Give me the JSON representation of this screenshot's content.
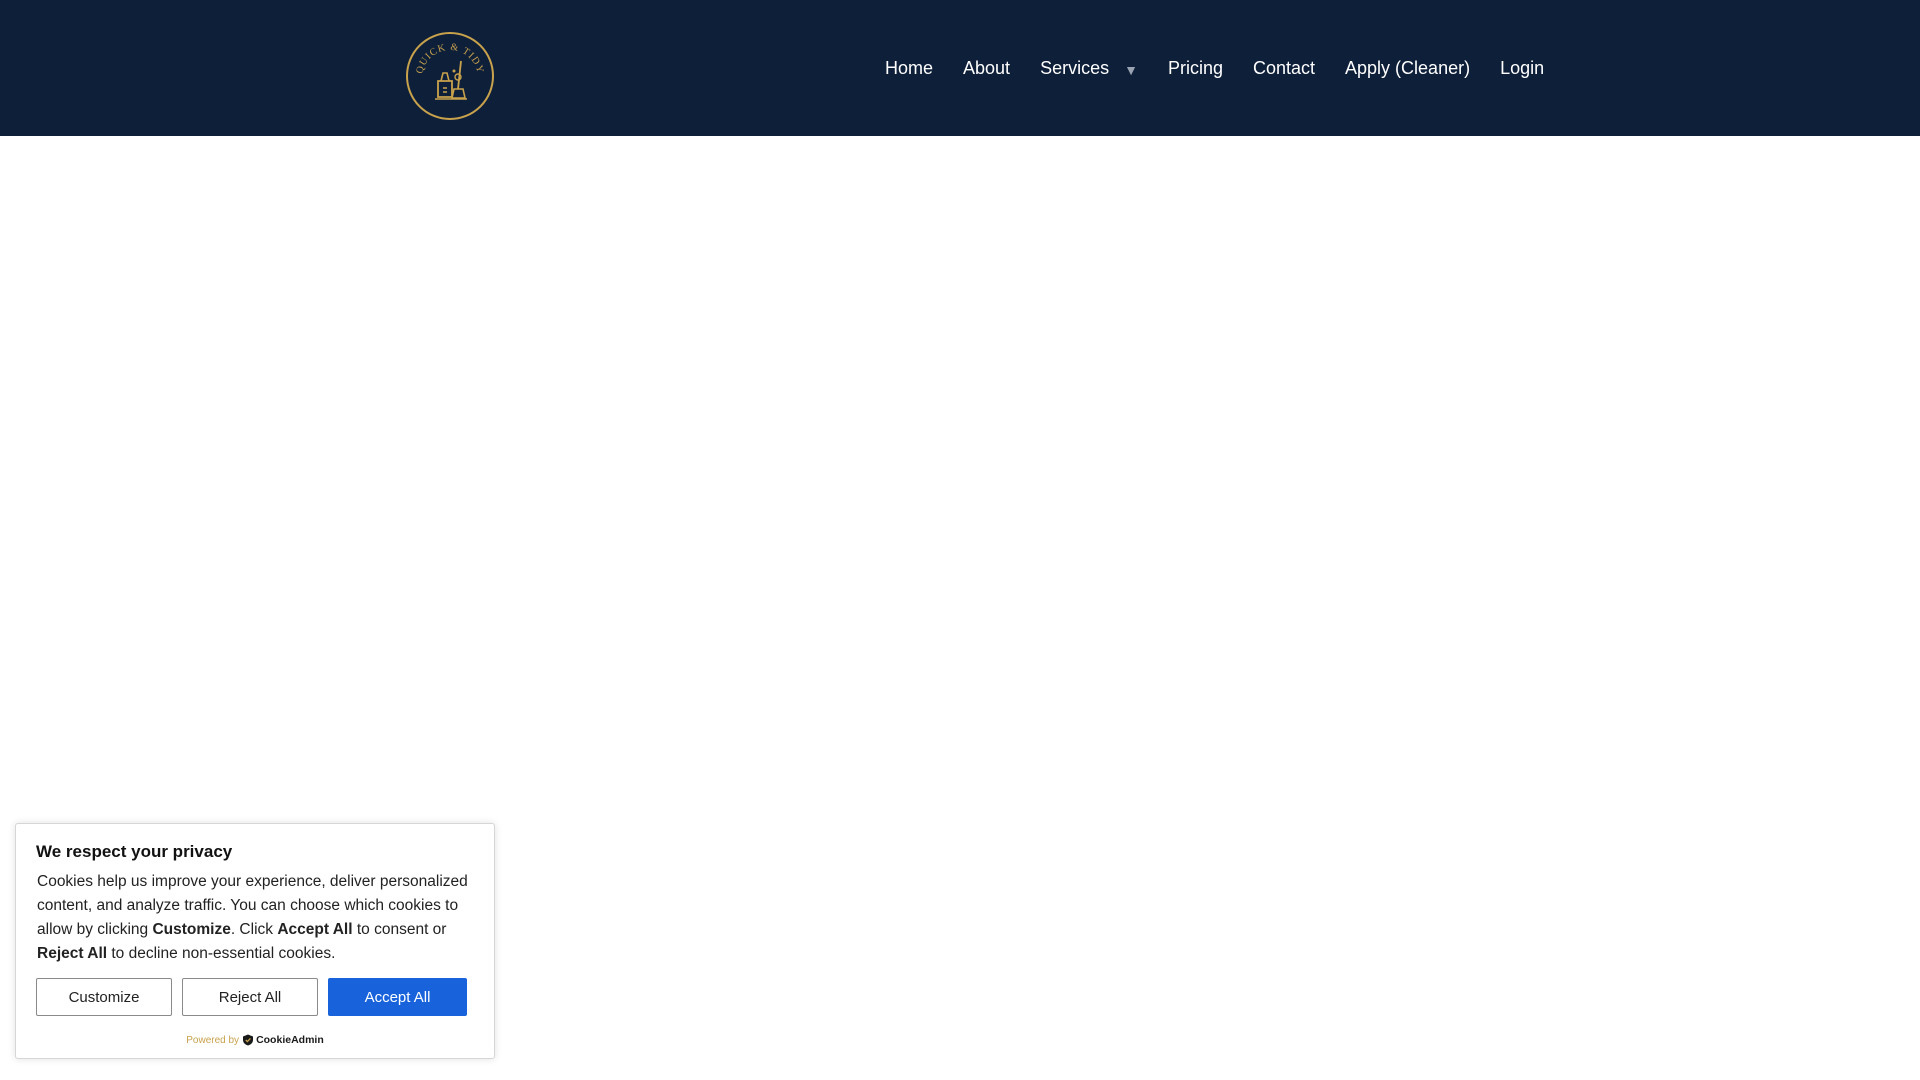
{
  "header": {
    "logo": {
      "text": "QUICK & TIDY",
      "ring_color": "#c9a24c"
    },
    "background": "#0e1f3a",
    "nav": [
      {
        "label": "Home"
      },
      {
        "label": "About"
      },
      {
        "label": "Services",
        "has_dropdown": true,
        "caret": "▼"
      },
      {
        "label": "Pricing"
      },
      {
        "label": "Contact"
      },
      {
        "label": "Apply (Cleaner)"
      },
      {
        "label": "Login"
      }
    ]
  },
  "cookie_banner": {
    "title": "We respect your privacy",
    "text_1": "Cookies help us improve your experience, deliver personalized content, and analyze traffic. You can choose which cookies to allow by clicking ",
    "bold_customize": "Customize",
    "text_2": ". Click ",
    "bold_accept": "Accept All",
    "text_3": " to consent or ",
    "bold_reject": "Reject All",
    "text_4": " to decline non-essential cookies.",
    "buttons": {
      "customize": "Customize",
      "reject": "Reject All",
      "accept": "Accept All"
    },
    "accent": "#1863dc",
    "powered_by": "Powered by",
    "brand": "CookieAdmin"
  }
}
